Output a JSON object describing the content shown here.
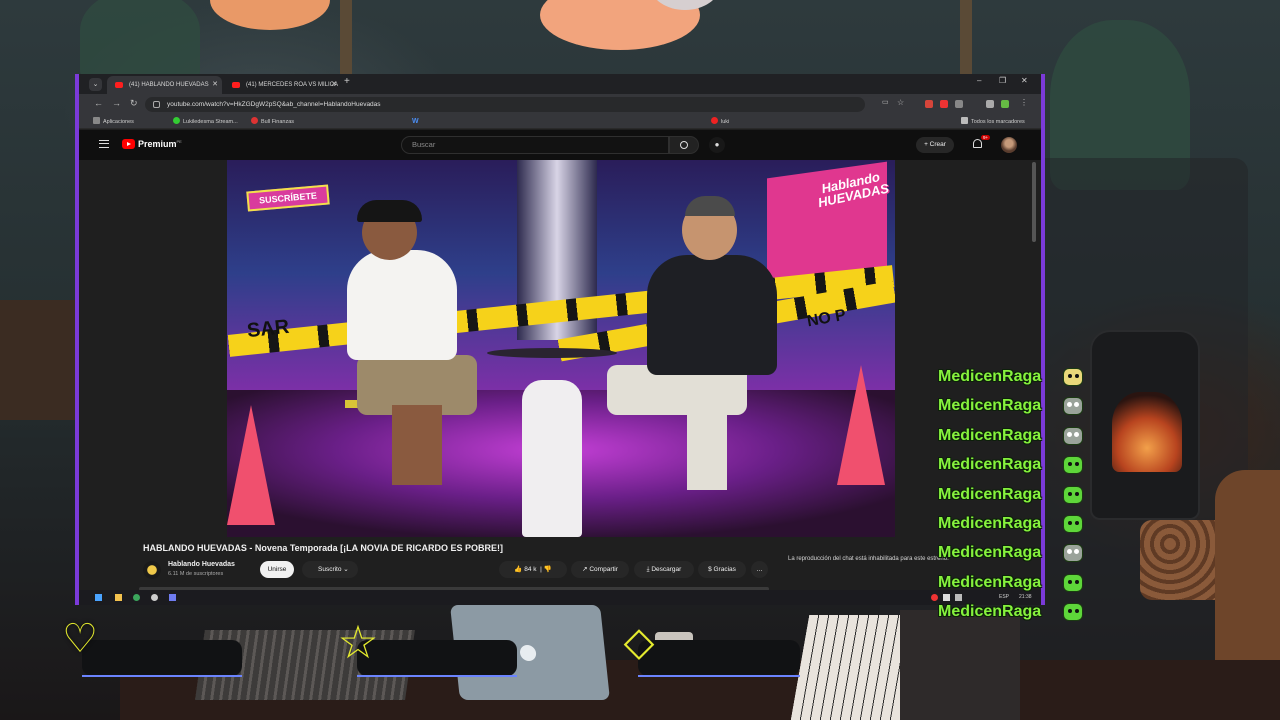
{
  "browser": {
    "tabs": [
      {
        "label": "(41) HABLANDO HUEVADAS",
        "active": true
      },
      {
        "label": "(41) MERCEDES ROA VS MILICA",
        "active": false
      }
    ],
    "new_tab": "+",
    "url": "youtube.com/watch?v=HkZGDgW2pSQ&ab_channel=HablandoHuevadas",
    "window_controls": {
      "minimize": "–",
      "maximize": "❐",
      "close": "✕"
    },
    "bookmarks": [
      {
        "label": "Aplicaciones"
      },
      {
        "label": "Lukiledesma Stream..."
      },
      {
        "label": "Bull Finanzas"
      },
      {
        "label": "W"
      },
      {
        "label": "luki"
      }
    ],
    "all_bookmarks": "Todos los marcadores"
  },
  "youtube": {
    "logo": "Premium",
    "logo_region": "PE",
    "search_placeholder": "Buscar",
    "create_label": "Crear",
    "notifications_badge": "9+",
    "video": {
      "subscribe_badge": "SUSCRÍBETE",
      "show_logo": "Hablando HUEVADAS",
      "tape_left": "SAR",
      "tape_right": "NO P"
    },
    "title": "HABLANDO HUEVADAS - Novena Temporada [¡LA NOVIA DE RICARDO ES POBRE!]",
    "channel": {
      "name": "Hablando Huevadas",
      "subscribers": "6.11 M de suscriptores"
    },
    "join_label": "Unirse",
    "subscribed_label": "Suscrito",
    "likes": "84 k",
    "share_label": "Compartir",
    "download_label": "Descargar",
    "thanks_label": "Gracias",
    "more_label": "…",
    "chat_disabled": "La reproducción del chat está inhabilitada para este estreno."
  },
  "taskbar": {
    "lang": "ESP",
    "time": "21:38"
  },
  "stream_chat": {
    "messages": [
      {
        "user": "MedicenRaga",
        "emote": "yellow-face"
      },
      {
        "user": "MedicenRaga",
        "emote": "grey-skull"
      },
      {
        "user": "MedicenRaga",
        "emote": "grey-skull"
      },
      {
        "user": "MedicenRaga",
        "emote": "green-face"
      },
      {
        "user": "MedicenRaga",
        "emote": "green-face"
      },
      {
        "user": "MedicenRaga",
        "emote": "green-face"
      },
      {
        "user": "MedicenRaga",
        "emote": "grey-skull"
      },
      {
        "user": "MedicenRaga",
        "emote": "green-face"
      },
      {
        "user": "MedicenRaga",
        "emote": "green-face"
      }
    ]
  },
  "overlay_icons": {
    "left": "heart-icon",
    "middle": "star-icon",
    "right": "diamond-icon"
  },
  "colors": {
    "accent": "#7b3ad9",
    "chat_green": "#86f23d",
    "overlay_yellow": "#e4ea2e",
    "youtube_red": "#ff0000"
  }
}
